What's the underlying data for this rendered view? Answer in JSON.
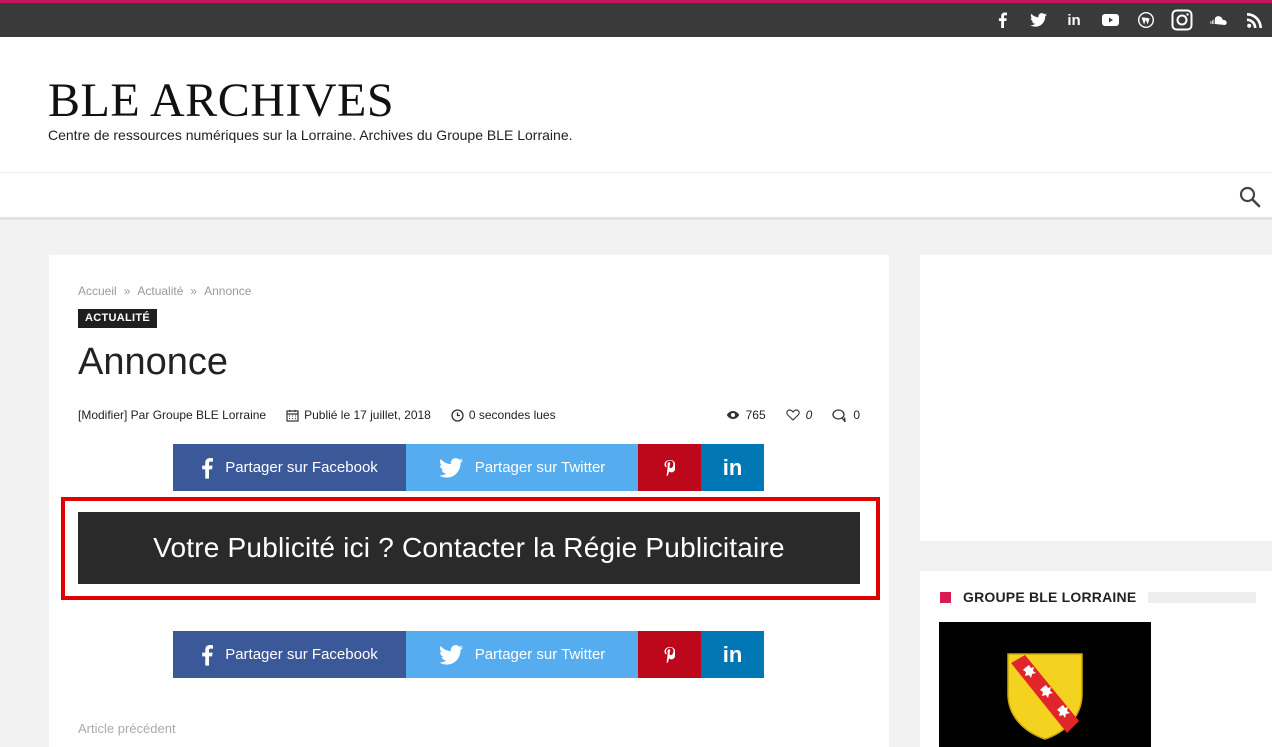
{
  "topbar": {
    "social_icons": [
      "facebook-icon",
      "twitter-icon",
      "linkedin-icon",
      "youtube-icon",
      "wordpress-icon",
      "instagram-icon",
      "soundcloud-icon",
      "rss-icon"
    ],
    "linkedin_text": "in"
  },
  "header": {
    "site_title": "BLE ARCHIVES",
    "tagline": "Centre de ressources numériques sur la Lorraine. Archives du Groupe BLE Lorraine."
  },
  "breadcrumb": {
    "items": [
      "Accueil",
      "Actualité",
      "Annonce"
    ],
    "separator": "»"
  },
  "post": {
    "category": "ACTUALITÉ",
    "title": "Annonce",
    "author_line": "[Modifier] Par Groupe BLE Lorraine",
    "published": "Publié le 17 juillet, 2018",
    "read_time": "0 secondes lues",
    "views": "765",
    "likes": "0",
    "comments": "0"
  },
  "share": {
    "facebook": "Partager sur Facebook",
    "twitter": "Partager sur Twitter",
    "linkedin": "in"
  },
  "ad": {
    "text": "Votre Publicité ici ? Contacter la Régie Publicitaire"
  },
  "nav_links": {
    "prev": "Article précédent"
  },
  "sidebar": {
    "widget_title": "GROUPE BLE LORRAINE"
  },
  "colors": {
    "topbar": "#3a3a3a",
    "accent": "#c2185b",
    "facebook": "#3b5898",
    "twitter": "#55acee",
    "pinterest": "#bd081c",
    "linkedin": "#0077b5",
    "ad_outline": "#e00000"
  }
}
